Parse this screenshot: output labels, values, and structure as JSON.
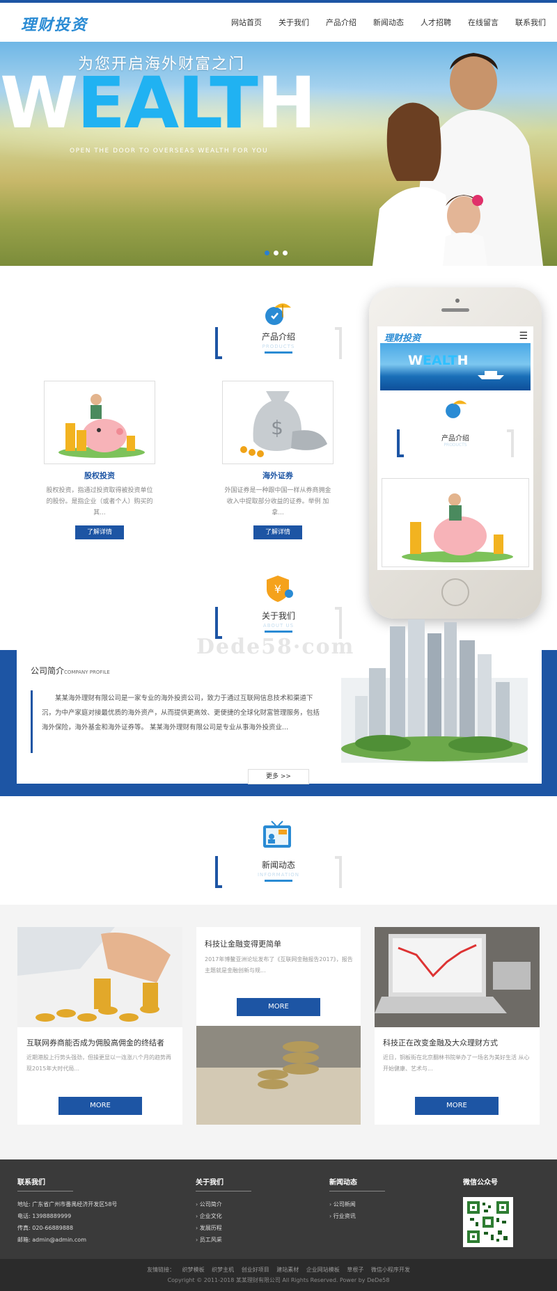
{
  "header": {
    "logo": "理财投资",
    "nav": [
      "网站首页",
      "关于我们",
      "产品介绍",
      "新闻动态",
      "人才招聘",
      "在线留言",
      "联系我们"
    ]
  },
  "hero": {
    "cn_title": "为您开启海外财富之门",
    "big_w": "W",
    "big_b": "EALT",
    "big_h": "H",
    "subtitle": "OPEN THE DOOR TO OVERSEAS WEALTH FOR YOU",
    "slide_count": 3,
    "active_slide": 1
  },
  "products": {
    "title": "产品介绍",
    "subtitle": "PRODUCTS",
    "items": [
      {
        "name": "股权投资",
        "desc": "股权投资，指通过投资取得被投资单位的股份。是指企业（或者个人）购买的其...",
        "button": "了解详情"
      },
      {
        "name": "海外证券",
        "desc": "外国证券是一种跟中国一样从券商拥金收入中提取部分收益的证券。举例 加拿...",
        "button": "了解详情"
      }
    ]
  },
  "phone_mockup": {
    "logo": "理财投资",
    "menu_icon": "hamburger-icon",
    "banner_w": "W",
    "banner_b": "EALT",
    "banner_h": "H",
    "section_title": "产品介绍",
    "section_subtitle": "PRODUCTS"
  },
  "watermark": "Dede58·com",
  "about": {
    "title": "关于我们",
    "subtitle": "ABOUT US",
    "heading": "公司简介",
    "heading_en": "COMPANY PROFILE",
    "text": "某某海外理财有限公司是一家专业的海外投资公司，致力于通过互联网信息技术和渠道下沉，为中产家庭对接最优质的海外资产，从而提供更高效、更便捷的全球化财富管理服务，包括海外保险，海外基金和海外证券等。 某某海外理财有限公司是专业从事海外投资业...",
    "more": "更多 >>"
  },
  "news": {
    "title": "新闻动态",
    "subtitle": "INFORMATION",
    "items": [
      {
        "title": "互联网券商能否成为佣股高佣金的终结者",
        "desc": "近期港股上行势头强劲，但操更显以一连涨八个月的趋势再现2015年大时代局...",
        "button": "MORE"
      },
      {
        "title": "科技让金融变得更简单",
        "desc": "2017年博鳌亚洲论坛发布了《互联网金融报告2017》，报告主题就是金融创新与规...",
        "button": "MORE"
      },
      {
        "title": "科技正在改变金融及大众理财方式",
        "desc": "近日，铜板街在北京翻林书院举办了一场名为美好生活 从心开始健康、艺术与...",
        "button": "MORE"
      }
    ]
  },
  "footer": {
    "contact": {
      "title": "联系我们",
      "lines": [
        "地址: 广东省广州市番禺经济开发区58号",
        "电话: 13988889999",
        "传真: 020-66889888",
        "邮箱: admin@admin.com"
      ]
    },
    "about": {
      "title": "关于我们",
      "items": [
        "公司简介",
        "企业文化",
        "发展历程",
        "员工风采"
      ]
    },
    "news": {
      "title": "新闻动态",
      "items": [
        "公司新闻",
        "行业资讯"
      ]
    },
    "wechat": {
      "title": "微信公众号"
    },
    "links_label": "友情链接：",
    "links": [
      "织梦模板",
      "织梦主机",
      "创业好项目",
      "建站素材",
      "企业网站模板",
      "草根子",
      "微信小程序开发"
    ],
    "copyright": "Copyright © 2011-2018 某某理财有限公司 All Rights Reserved. Power by DeDe58"
  },
  "colors": {
    "brand_blue": "#1d55a4",
    "accent_cyan": "#20b2f2",
    "logo_blue": "#2a8bd4"
  }
}
